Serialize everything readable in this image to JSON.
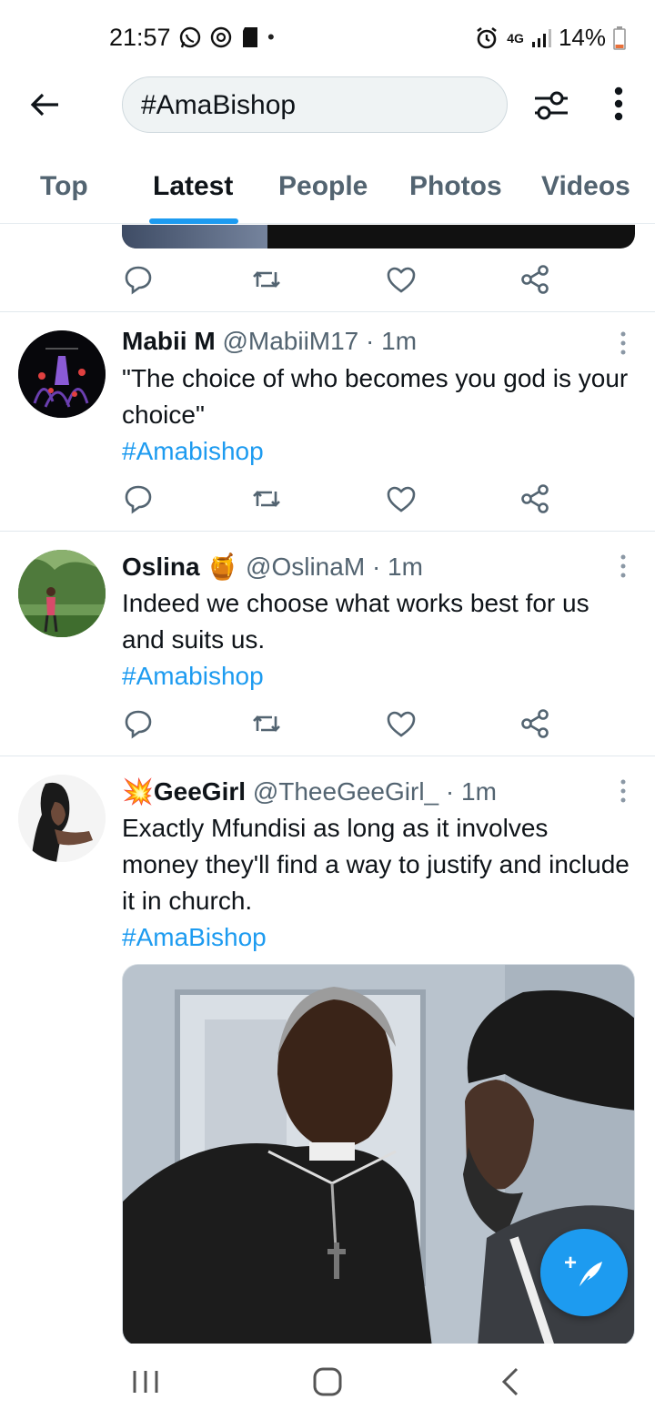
{
  "status_bar": {
    "time": "21:57",
    "network": "4G",
    "battery": "14%"
  },
  "header": {
    "search_query": "#AmaBishop"
  },
  "tabs": [
    {
      "label": "Top"
    },
    {
      "label": "Latest"
    },
    {
      "label": "People"
    },
    {
      "label": "Photos"
    },
    {
      "label": "Videos"
    }
  ],
  "active_tab": "Latest",
  "tweets": [
    {
      "name": "Mabii M",
      "handle": "@MabiiM17",
      "sep": "·",
      "time": "1m",
      "text": "\"The choice of who becomes you god is your choice\"",
      "hashtag": "#Amabishop"
    },
    {
      "name": "Oslina",
      "emoji": "🍯",
      "handle": "@OslinaM",
      "sep": "·",
      "time": "1m",
      "text": "Indeed we choose what works best for us and suits us.",
      "hashtag": "#Amabishop"
    },
    {
      "name_prefix_emoji": "💥",
      "name": "GeeGirl",
      "handle": "@TheeGeeGirl_",
      "sep": "·",
      "time": "1m",
      "text": "Exactly Mfundisi as long as it involves money they'll find a way to justify and include it in church.",
      "hashtag": "#AmaBishop"
    }
  ],
  "colors": {
    "accent": "#1d9bf0",
    "text": "#0f1419",
    "secondary": "#536471"
  },
  "fab": {
    "plus": "+"
  }
}
